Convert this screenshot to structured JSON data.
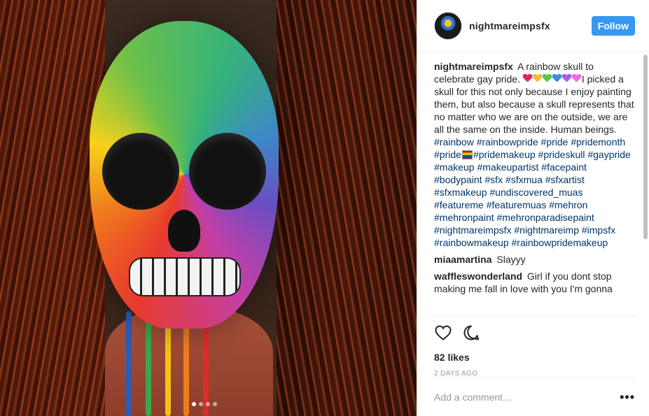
{
  "post": {
    "username": "nightmareimpsfx",
    "follow_label": "Follow",
    "photo": {
      "carousel_dots": 4,
      "active_dot": 0
    }
  },
  "caption": {
    "user": "nightmareimpsfx",
    "text_1": "A rainbow skull to celebrate gay pride.",
    "hearts": [
      "#e0245e",
      "#f6b93b",
      "#5cc34b",
      "#3d8be0",
      "#a55eea",
      "#f368e0"
    ],
    "text_2": "I picked a skull for this not only because I enjoy painting them, but also because a skull represents that no matter who we are on the outside, we are all the same on the inside. Human beings.",
    "tags_a": "#rainbow #rainbowpride #pride #pridemonth #pride",
    "tags_b": "#pridemakeup #prideskull #gaypride #makeup #makeupartist #facepaint #bodypaint #sfx #sfxmua #sfxartist #sfxmakeup #undiscovered_muas #featureme #featuremuas #mehron #mehronpaint #mehronparadisepaint #nightmareimpsfx #nightmareimp #impsfx #rainbowmakeup #rainbowpridemakeup"
  },
  "comments": [
    {
      "user": "miaamartina",
      "text": "Slayyy"
    },
    {
      "user": "waffleswonderland",
      "text": "Girl if you dont stop making me fall in love with you I'm gonna"
    }
  ],
  "actions": {
    "like_icon": "heart-outline-icon",
    "comment_icon": "speech-bubble-icon",
    "likes": "82 likes",
    "timestamp": "2 DAYS AGO"
  },
  "add_comment": {
    "placeholder": "Add a comment…",
    "more_icon": "ellipsis-icon",
    "more_label": "•••"
  }
}
